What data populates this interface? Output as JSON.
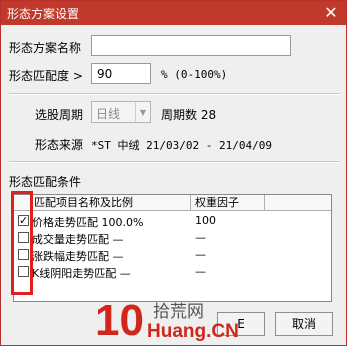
{
  "window": {
    "title": "形态方案设置",
    "close_glyph": "✕"
  },
  "form": {
    "name_label": "形态方案名称",
    "name_value": "",
    "match_label": "形态匹配度 >",
    "match_value": "90",
    "match_unit": "% (0-100%)",
    "period_label": "选股周期",
    "period_value": "日线",
    "period_count_label": "周期数 28",
    "source_label": "形态来源",
    "source_value": "*ST 中绒 21/03/02 - 21/04/09"
  },
  "conditions": {
    "section_label": "形态匹配条件",
    "columns": [
      "匹配项目名称及比例",
      "权重因子"
    ],
    "rows": [
      {
        "checked": true,
        "name": "价格走势匹配 100.0%",
        "weight": "100"
      },
      {
        "checked": false,
        "name": "成交量走势匹配 —",
        "weight": "—"
      },
      {
        "checked": false,
        "name": "涨跌幅走势匹配 —",
        "weight": "—"
      },
      {
        "checked": false,
        "name": "K线阴阳走势匹配 —",
        "weight": "—"
      }
    ]
  },
  "buttons": {
    "ok": "E",
    "cancel": "取消"
  },
  "watermark": {
    "digits": "10",
    "cn": "拾荒网",
    "domain": "Huang.CN"
  },
  "colors": {
    "titlebar": "#c0392b",
    "highlight": "#e02020",
    "watermark": "#d0261c"
  }
}
